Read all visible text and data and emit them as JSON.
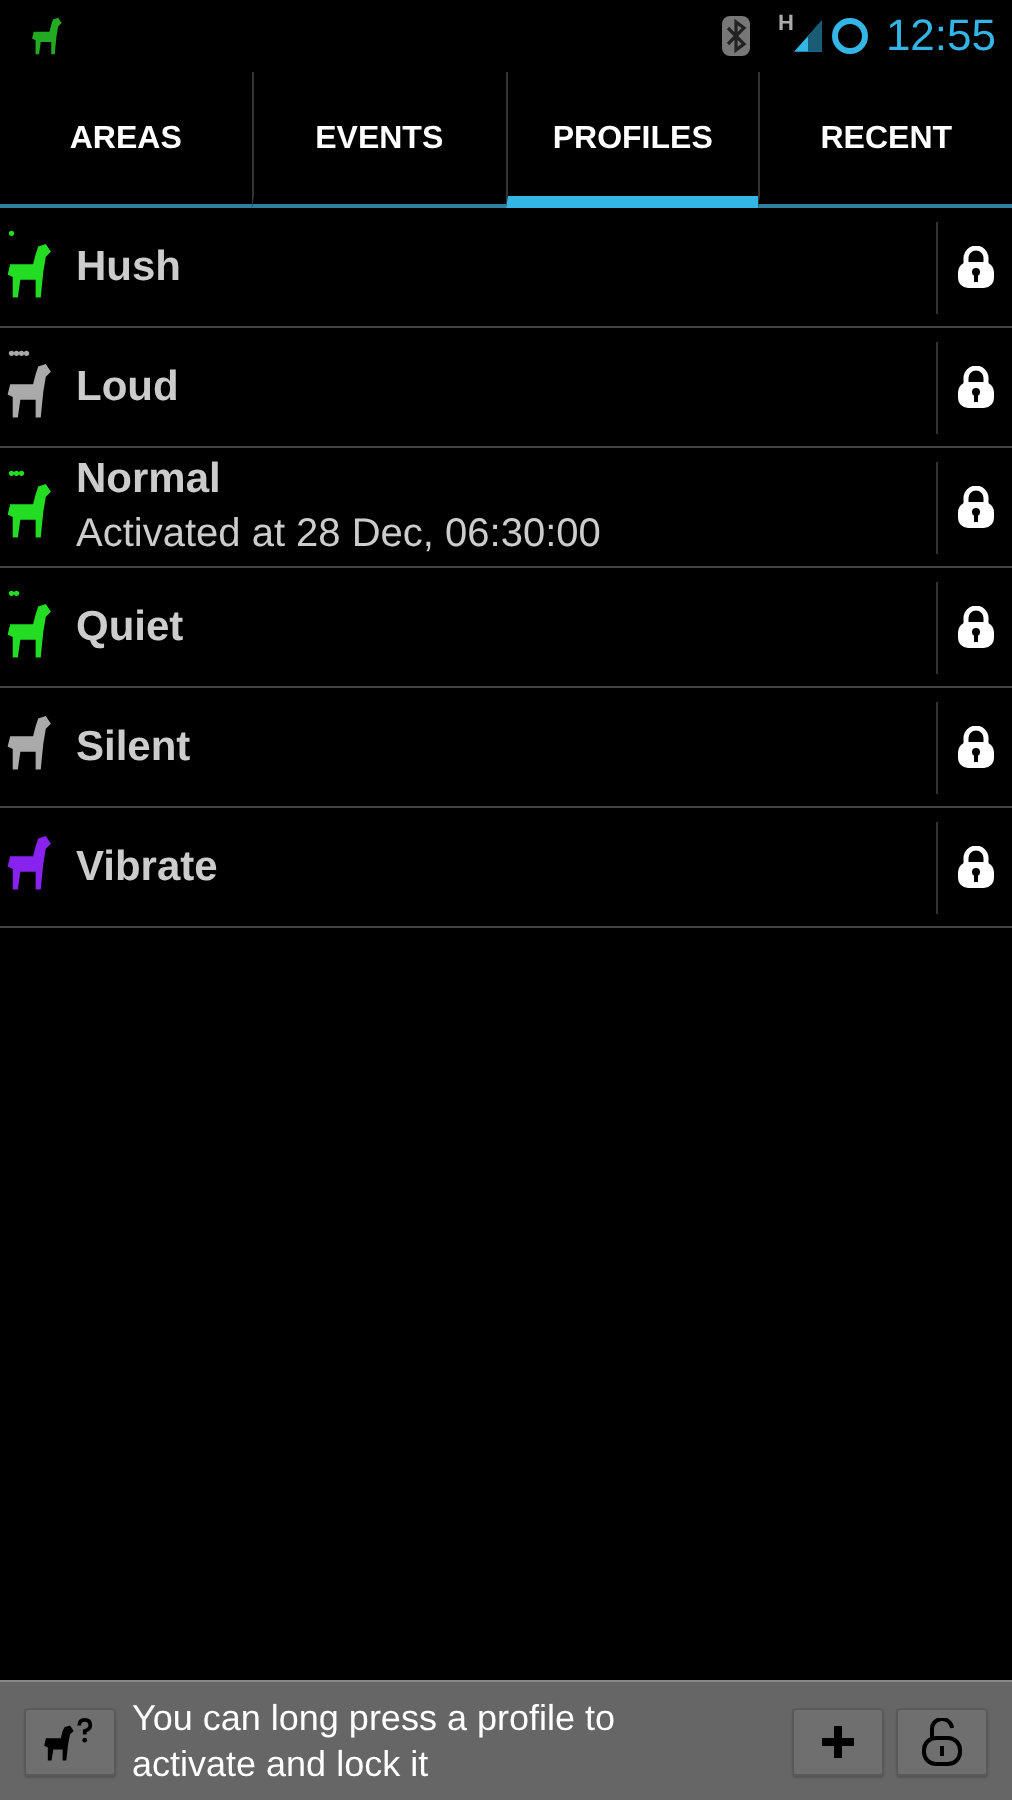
{
  "status_bar": {
    "network_type": "H",
    "time": "12:55"
  },
  "tabs": [
    {
      "label": "AREAS",
      "selected": false
    },
    {
      "label": "EVENTS",
      "selected": false
    },
    {
      "label": "PROFILES",
      "selected": true
    },
    {
      "label": "RECENT",
      "selected": false
    }
  ],
  "profiles": [
    {
      "name": "Hush",
      "volume_marks": "•",
      "color": "#22dd22"
    },
    {
      "name": "Loud",
      "volume_marks": "••••",
      "color": "#aaaaaa"
    },
    {
      "name": "Normal",
      "volume_marks": "•••",
      "color": "#22dd22",
      "detail": "Activated at 28 Dec, 06:30:00"
    },
    {
      "name": "Quiet",
      "volume_marks": "••",
      "color": "#22dd22"
    },
    {
      "name": "Silent",
      "color": "#aaaaaa"
    },
    {
      "name": "Vibrate",
      "color": "#8822ee"
    }
  ],
  "hint": "You can long press a profile to activate and lock it"
}
